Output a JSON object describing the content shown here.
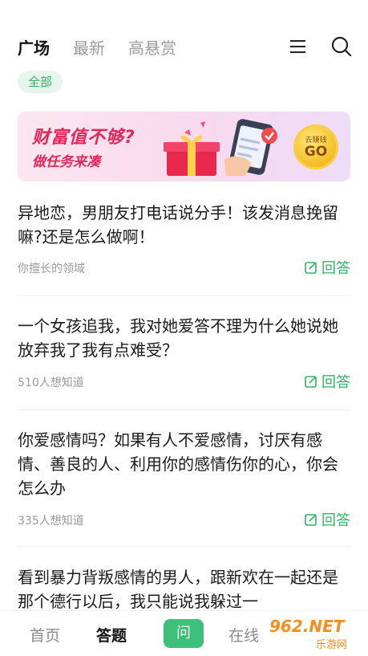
{
  "header": {
    "tabs": [
      {
        "label": "广场",
        "active": true
      },
      {
        "label": "最新",
        "active": false
      },
      {
        "label": "高悬赏",
        "active": false
      }
    ],
    "menu_icon": "menu-icon",
    "search_icon": "search-icon"
  },
  "filter": {
    "chip_label": "全部"
  },
  "banner": {
    "line1": "财富值不够?",
    "line2": "做任务来凑",
    "coin_top": "去赚钱",
    "coin_main": "GO"
  },
  "questions": [
    {
      "title": "异地恋，男朋友打电话说分手！该发消息挽留嘛?还是怎么做啊！",
      "meta": "你擅长的领域",
      "answer_label": "回答"
    },
    {
      "title": "一个女孩追我，我对她爱答不理为什么她说她放弃我了我有点难受？",
      "meta": "510人想知道",
      "answer_label": "回答"
    },
    {
      "title": "你爱感情吗？如果有人不爱感情，讨厌有感情、善良的人、利用你的感情伤你的心，你会怎么办",
      "meta": "335人想知道",
      "answer_label": "回答"
    },
    {
      "title": "看到暴力背叛感情的男人，跟新欢在一起还是那个德行以后，我只能说我躲过一",
      "meta": "",
      "answer_label": ""
    }
  ],
  "bottom_nav": {
    "items": [
      {
        "label": "首页",
        "active": false
      },
      {
        "label": "答题",
        "active": true
      },
      {
        "label": "问",
        "active": false
      },
      {
        "label": "在线",
        "active": false
      }
    ]
  },
  "watermark": {
    "main": "962.NET",
    "sub": "乐游网"
  },
  "colors": {
    "accent": "#2fb364",
    "banner_text": "#e0285a",
    "ask_button": "#3fc07a"
  }
}
